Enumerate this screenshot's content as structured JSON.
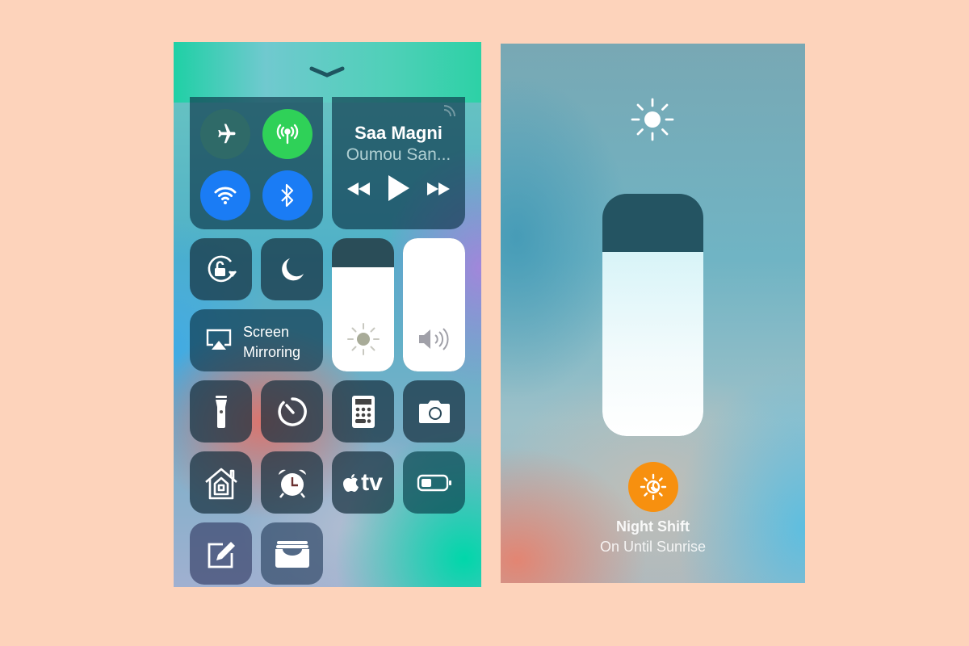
{
  "left_panel": {
    "connectivity": {
      "airplane": false,
      "cellular": true,
      "wifi": true,
      "bluetooth": true
    },
    "colors": {
      "cellular": "#2fd158",
      "wifi": "#1a7cf5",
      "bluetooth": "#1a7cf5",
      "airplane": "#2f6a68"
    },
    "now_playing": {
      "title": "Saa Magni",
      "artist": "Oumou San..."
    },
    "screen_mirroring": {
      "line1": "Screen",
      "line2": "Mirroring"
    },
    "brightness_level_pct": 78,
    "volume_level_pct": 100,
    "tiles": [
      "flashlight-icon",
      "timer-icon",
      "calculator-icon",
      "camera-icon",
      "home-icon",
      "alarm-icon",
      "apple-tv-icon",
      "low-power-icon",
      "notes-icon",
      "wallet-icon"
    ],
    "apple_tv_label": "tv"
  },
  "right_panel": {
    "brightness_level_pct": 76,
    "night_shift": {
      "title": "Night Shift",
      "status": "On Until Sunrise",
      "color": "#f7900f"
    }
  }
}
